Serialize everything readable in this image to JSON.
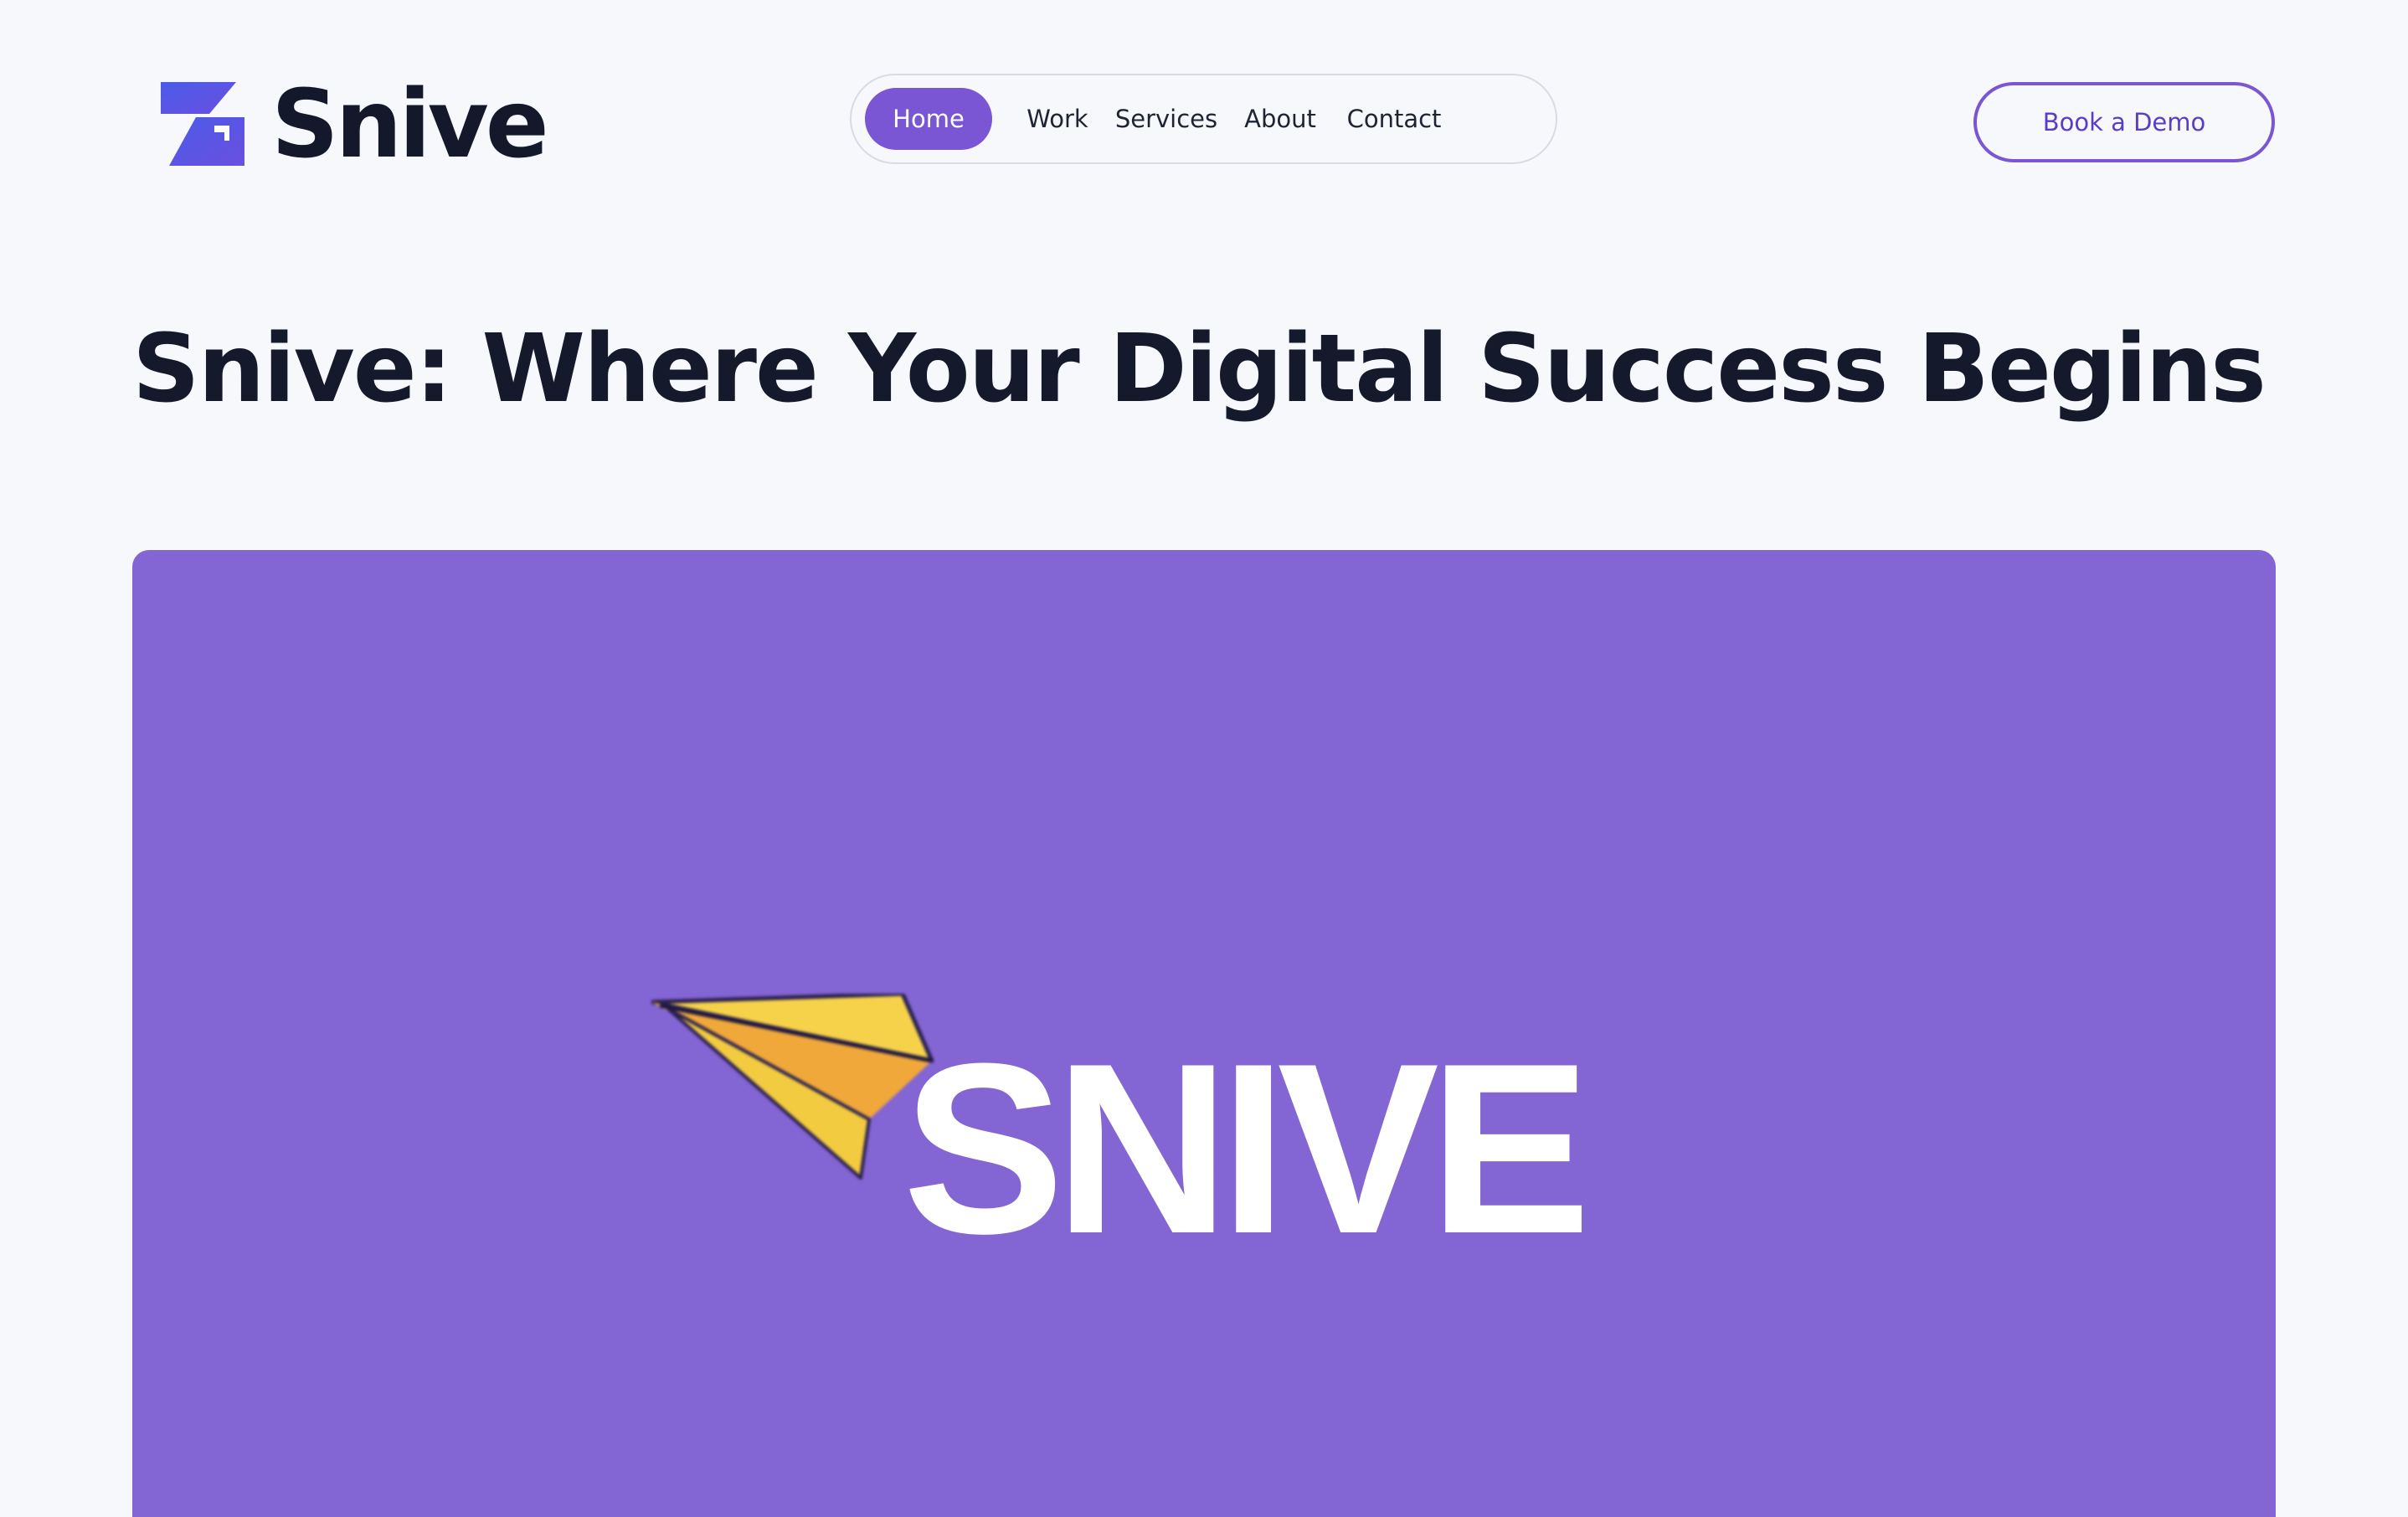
{
  "brand": {
    "name": "Snive",
    "icon": "snive-logo-icon",
    "accent": "#5a4ee0"
  },
  "nav": {
    "items": [
      {
        "label": "Home",
        "active": true
      },
      {
        "label": "Work",
        "active": false
      },
      {
        "label": "Services",
        "active": false
      },
      {
        "label": "About",
        "active": false
      },
      {
        "label": "Contact",
        "active": false
      }
    ]
  },
  "cta": {
    "label": "Book a Demo"
  },
  "hero": {
    "title": "Snive: Where Your Digital Success Begins",
    "banner": {
      "wordmark": "SNIVE",
      "icon": "paper-plane-icon",
      "background": "#8465d4"
    }
  },
  "colors": {
    "accent": "#7a55d4",
    "page_background": "#f7f8fc",
    "heading": "#141a2b"
  }
}
